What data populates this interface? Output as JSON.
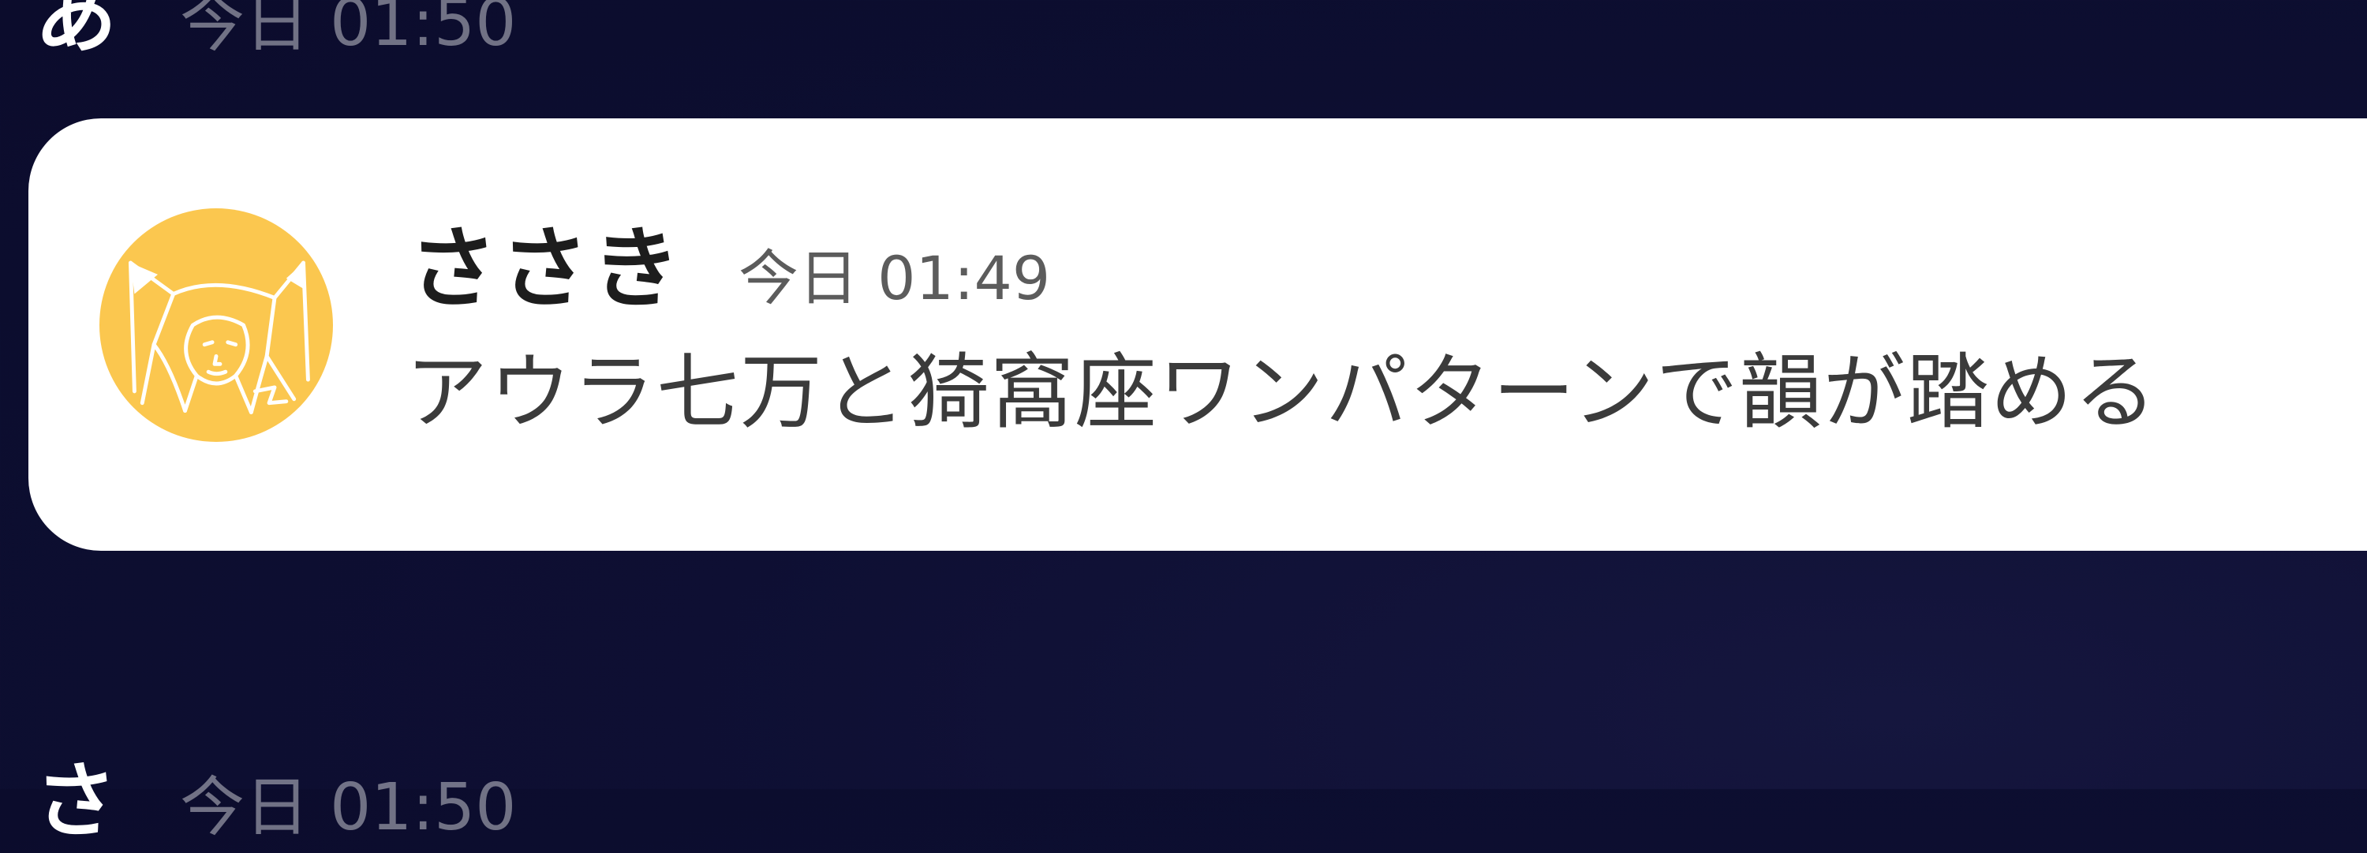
{
  "prev_message": {
    "name": "あ",
    "time": "今日 01:50"
  },
  "notification": {
    "sender": "ささき",
    "time": "今日 01:49",
    "text": "アウラ七万と猗窩座ワンパターンで韻が踏める",
    "avatar_color": "#fbc74f",
    "avatar_icon": "cat-sketch-avatar"
  },
  "next_message": {
    "name": "さ",
    "time": "今日 01:50"
  },
  "colors": {
    "background": "#0e0f33",
    "card": "#ffffff",
    "sender_text": "#1d1d1d",
    "message_text": "#3b3b3b",
    "timestamp_text": "#5c5c5c"
  }
}
